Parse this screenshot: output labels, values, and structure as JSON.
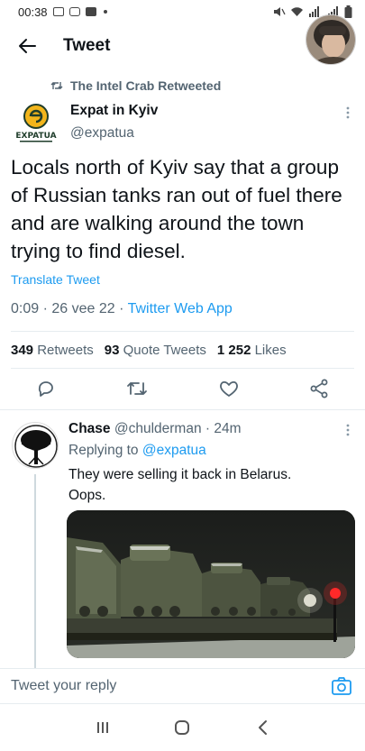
{
  "status_bar": {
    "time": "00:38"
  },
  "header": {
    "title": "Tweet"
  },
  "retweet": {
    "text": "The Intel Crab Retweeted"
  },
  "tweet": {
    "author_name": "Expat in Kyiv",
    "author_handle": "@expatua",
    "logo_text": "EXPATUA",
    "text": "Locals north of Kyiv say that a group of Russian tanks ran out of fuel there and are walking around the town trying to find diesel.",
    "translate_label": "Translate Tweet",
    "time": "0:09",
    "date": "26 vee 22",
    "source": "Twitter Web App",
    "retweets_count": "349",
    "retweets_label": "Retweets",
    "quotes_count": "93",
    "quotes_label": "Quote Tweets",
    "likes_count": "1 252",
    "likes_label": "Likes"
  },
  "reply": {
    "name": "Chase",
    "handle": "@chulderman",
    "age": "24m",
    "replying_prefix": "Replying to",
    "replying_handle": "@expatua",
    "text_line1": "They were selling it back in Belarus.",
    "text_line2": "Oops."
  },
  "composer": {
    "placeholder": "Tweet your reply"
  },
  "colors": {
    "accent": "#1d9bf0",
    "muted": "#536471",
    "text": "#0f1419"
  },
  "icons": [
    "back-arrow-icon",
    "retweet-icon",
    "more-icon",
    "reply-icon",
    "like-icon",
    "share-icon",
    "camera-icon",
    "recents-icon",
    "home-icon",
    "nav-back-icon"
  ]
}
